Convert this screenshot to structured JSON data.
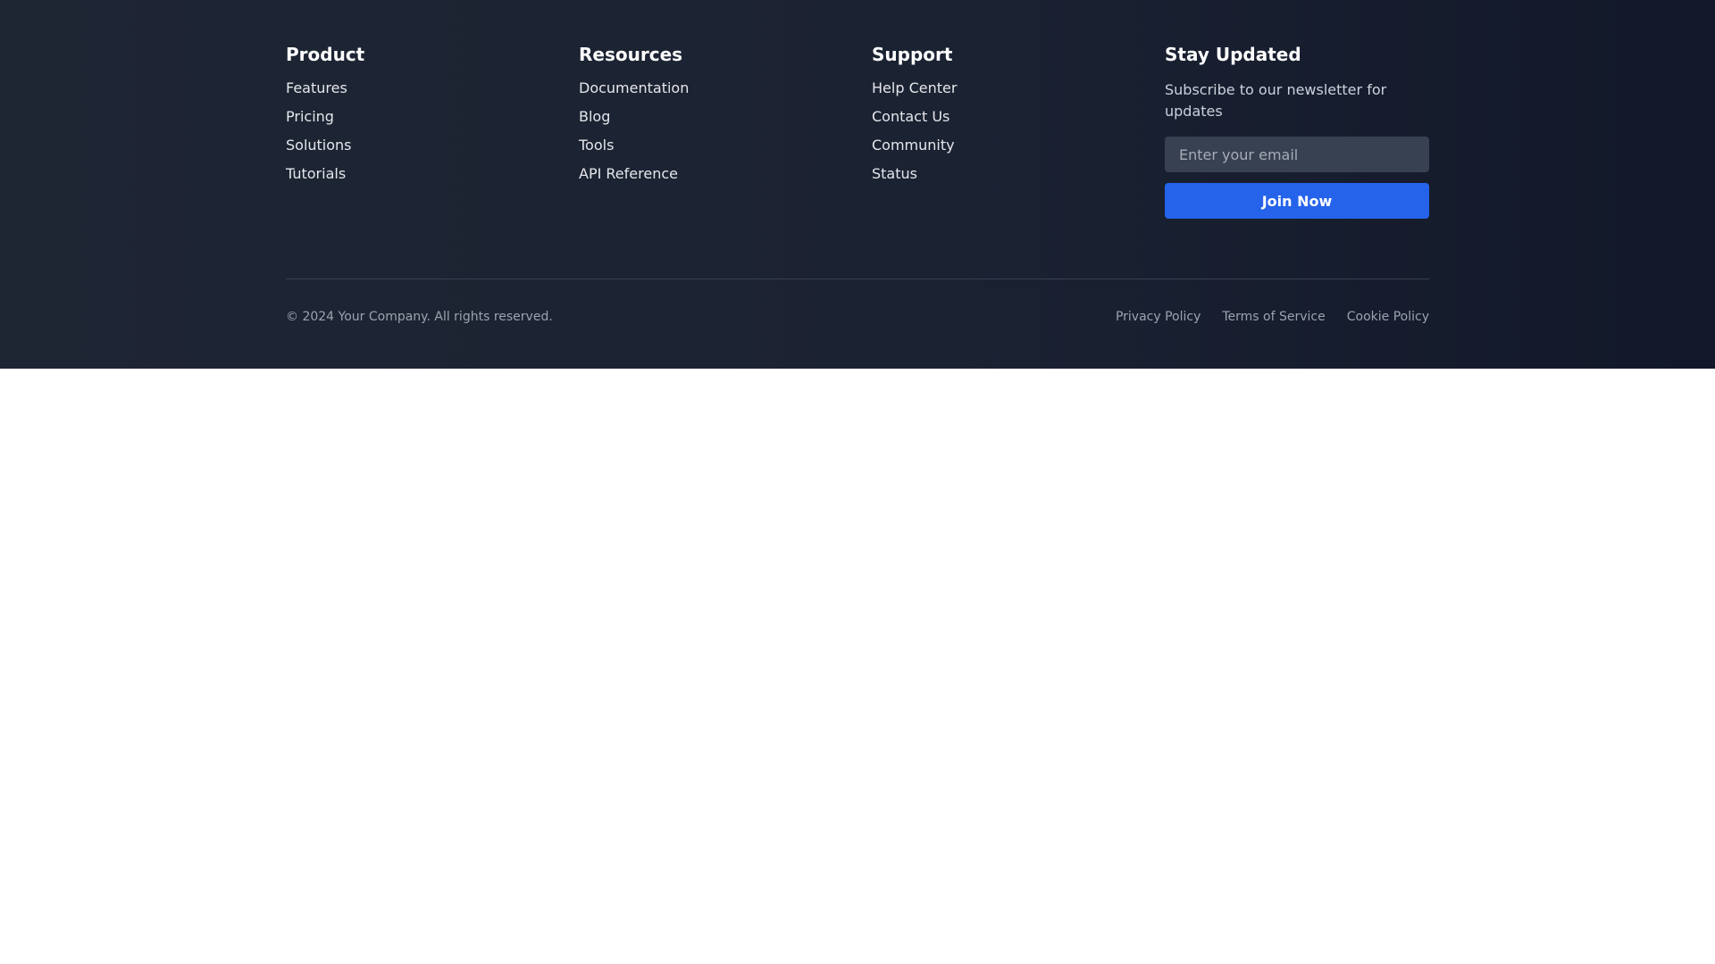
{
  "colors": {
    "background": "#1e2533",
    "accent": "#2563eb",
    "input_bg": "#374151",
    "divider": "#374151",
    "muted_text": "#9ca3af"
  },
  "product": {
    "title": "Product",
    "links": [
      "Features",
      "Pricing",
      "Solutions",
      "Tutorials"
    ]
  },
  "resources": {
    "title": "Resources",
    "links": [
      "Documentation",
      "Blog",
      "Tools",
      "API Reference"
    ]
  },
  "support": {
    "title": "Support",
    "links": [
      "Help Center",
      "Contact Us",
      "Community",
      "Status"
    ]
  },
  "newsletter": {
    "title": "Stay Updated",
    "description": "Subscribe to our newsletter for updates",
    "email_placeholder": "Enter your email",
    "email_value": "",
    "button_label": "Join Now"
  },
  "bottom": {
    "copyright": "© 2024 Your Company. All rights reserved.",
    "legal_links": [
      "Privacy Policy",
      "Terms of Service",
      "Cookie Policy"
    ]
  }
}
